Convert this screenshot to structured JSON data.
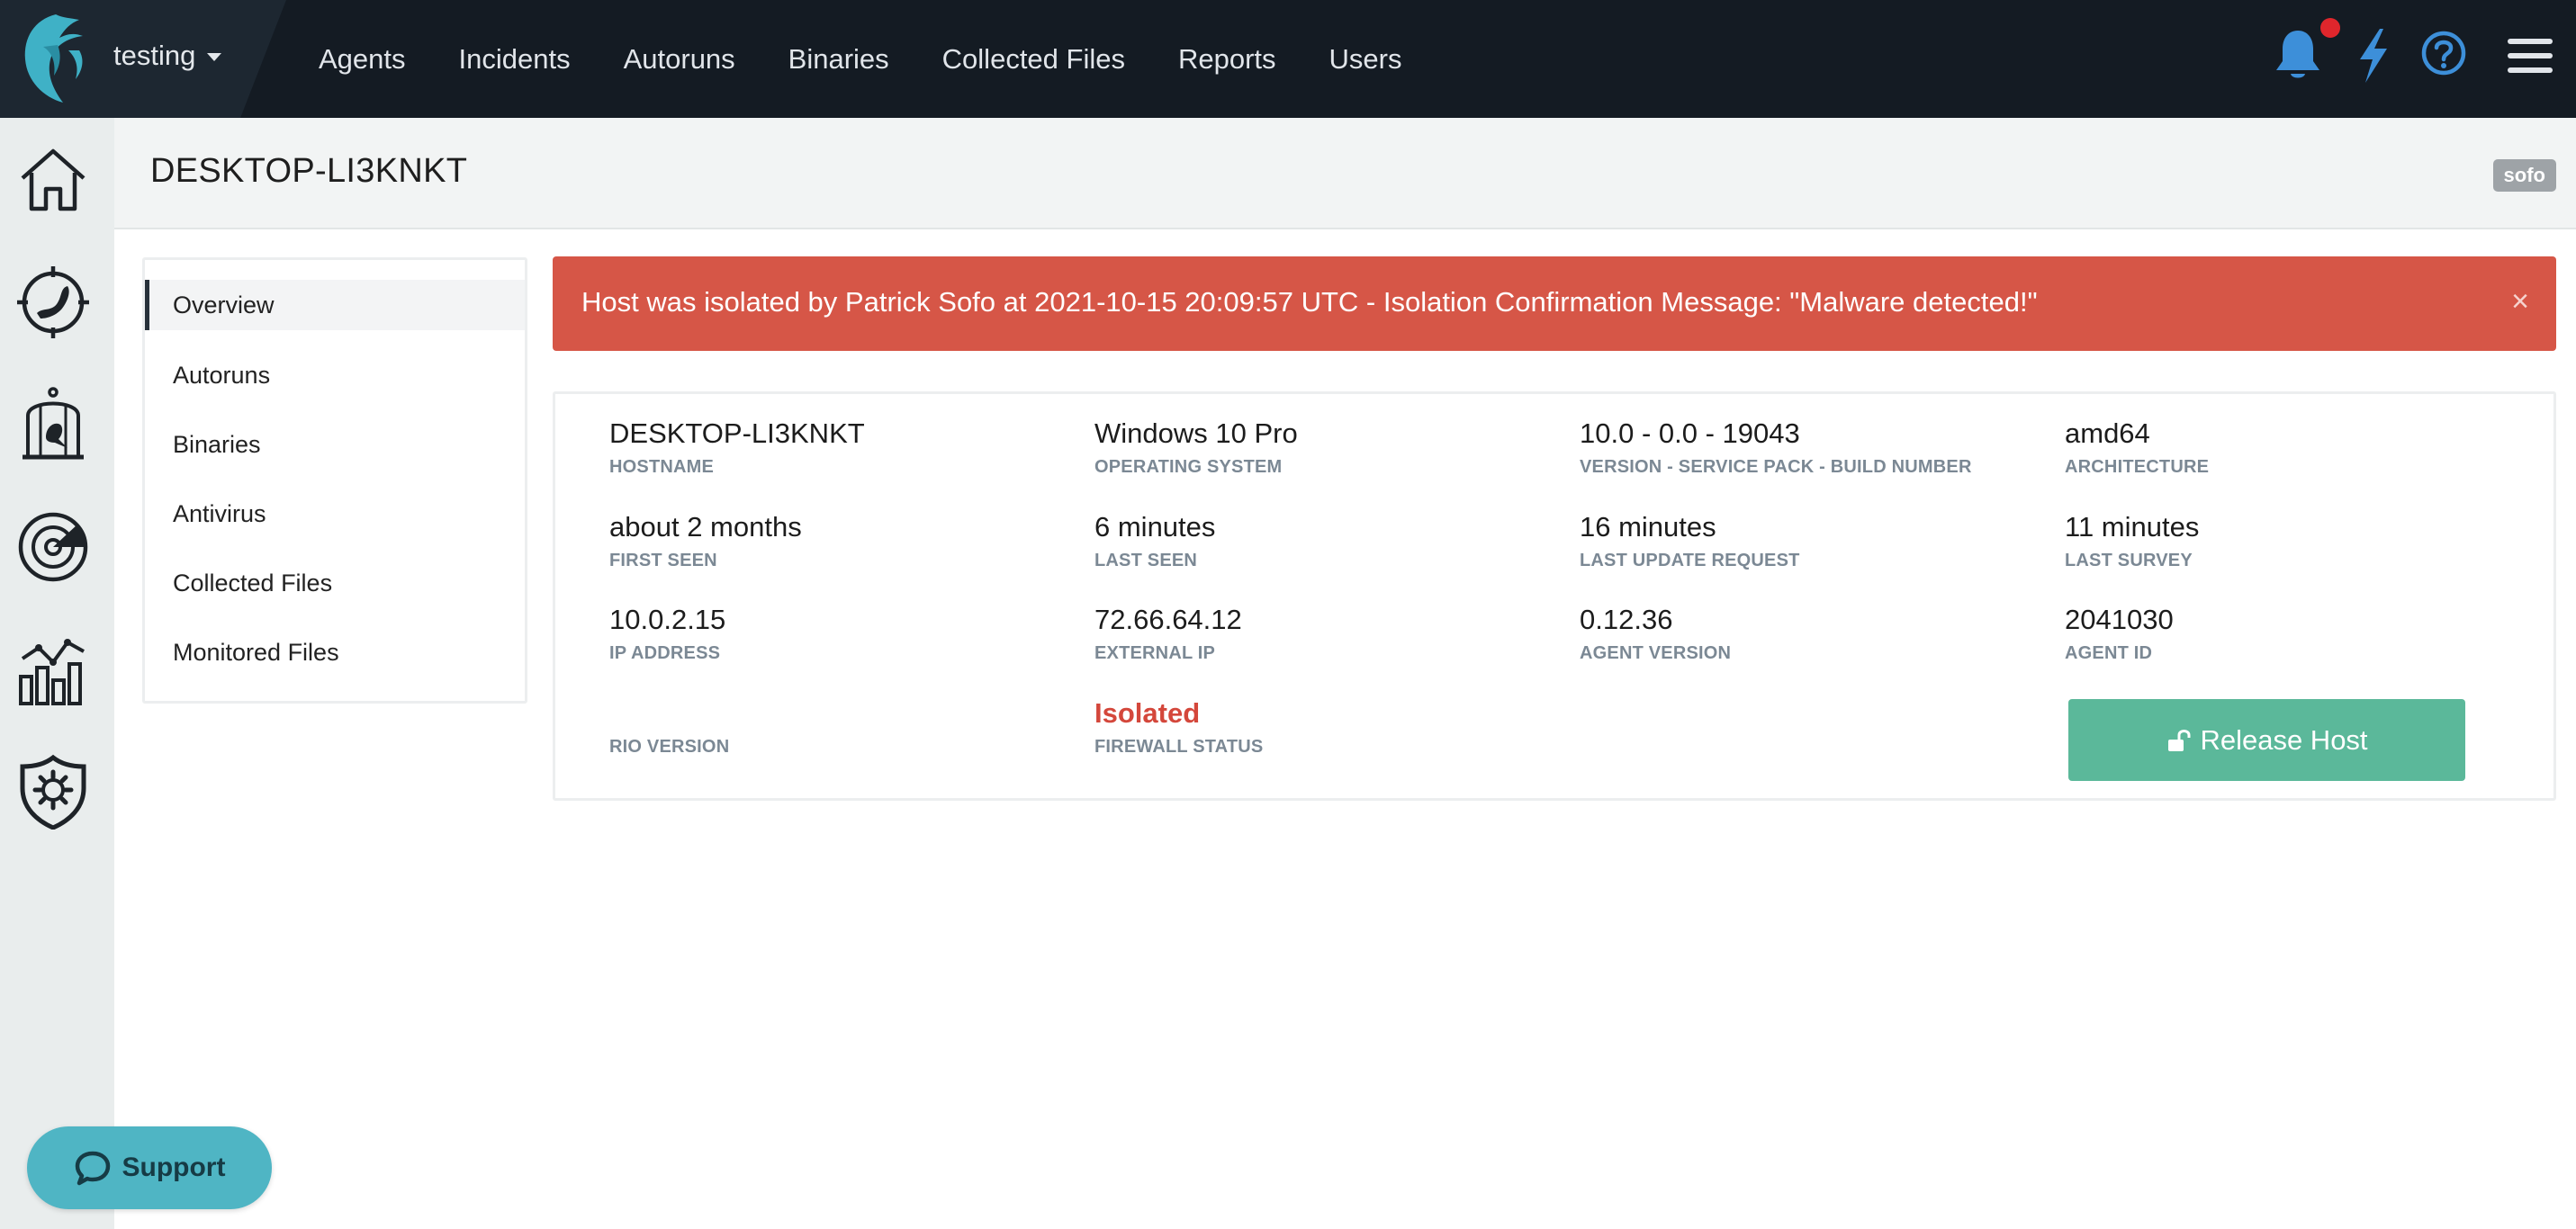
{
  "tenant": {
    "name": "testing"
  },
  "nav": {
    "items": [
      "Agents",
      "Incidents",
      "Autoruns",
      "Binaries",
      "Collected Files",
      "Reports",
      "Users"
    ]
  },
  "page": {
    "title": "DESKTOP-LI3KNKT",
    "user_badge": "sofo"
  },
  "subnav": {
    "items": [
      "Overview",
      "Autoruns",
      "Binaries",
      "Antivirus",
      "Collected Files",
      "Monitored Files"
    ],
    "active": "Overview"
  },
  "alert": {
    "text": "Host was isolated by Patrick Sofo at 2021-10-15 20:09:57 UTC - Isolation Confirmation Message: \"Malware detected!\"",
    "close_glyph": "×"
  },
  "host": {
    "hostname": {
      "value": "DESKTOP-LI3KNKT",
      "label": "Hostname"
    },
    "os": {
      "value": "Windows 10 Pro",
      "label": "Operating System"
    },
    "version": {
      "value": "10.0 - 0.0 - 19043",
      "label": "Version - Service Pack - Build Number"
    },
    "arch": {
      "value": "amd64",
      "label": "Architecture"
    },
    "first_seen": {
      "value": "about 2 months",
      "label": "First Seen"
    },
    "last_seen": {
      "value": "6 minutes",
      "label": "Last Seen"
    },
    "last_update": {
      "value": "16 minutes",
      "label": "Last Update Request"
    },
    "last_survey": {
      "value": "11 minutes",
      "label": "Last Survey"
    },
    "ip": {
      "value": "10.0.2.15",
      "label": "IP Address"
    },
    "external_ip": {
      "value": "72.66.64.12",
      "label": "External IP"
    },
    "agent_version": {
      "value": "0.12.36",
      "label": "Agent Version"
    },
    "agent_id": {
      "value": "2041030",
      "label": "Agent ID"
    },
    "rio_version": {
      "value": "",
      "label": "RIO Version"
    },
    "firewall": {
      "value": "Isolated",
      "label": "Firewall Status"
    }
  },
  "release_button": {
    "label": "Release Host",
    "icon": "unlock-icon"
  },
  "support": {
    "label": "Support",
    "icon": "chat-icon"
  },
  "icons": {
    "top": [
      "bell-icon",
      "lightning-icon",
      "help-icon",
      "menu-icon"
    ],
    "rail": [
      "home-icon",
      "threat-hunt-icon",
      "cage-icon",
      "radar-icon",
      "analytics-icon",
      "shield-gear-icon"
    ]
  },
  "colors": {
    "topbar": "#141b23",
    "alert": "#d65647",
    "accent_blue": "#3d8fd9",
    "release": "#5bb89a",
    "isolated": "#d4473b",
    "support": "#4fb5c4"
  }
}
